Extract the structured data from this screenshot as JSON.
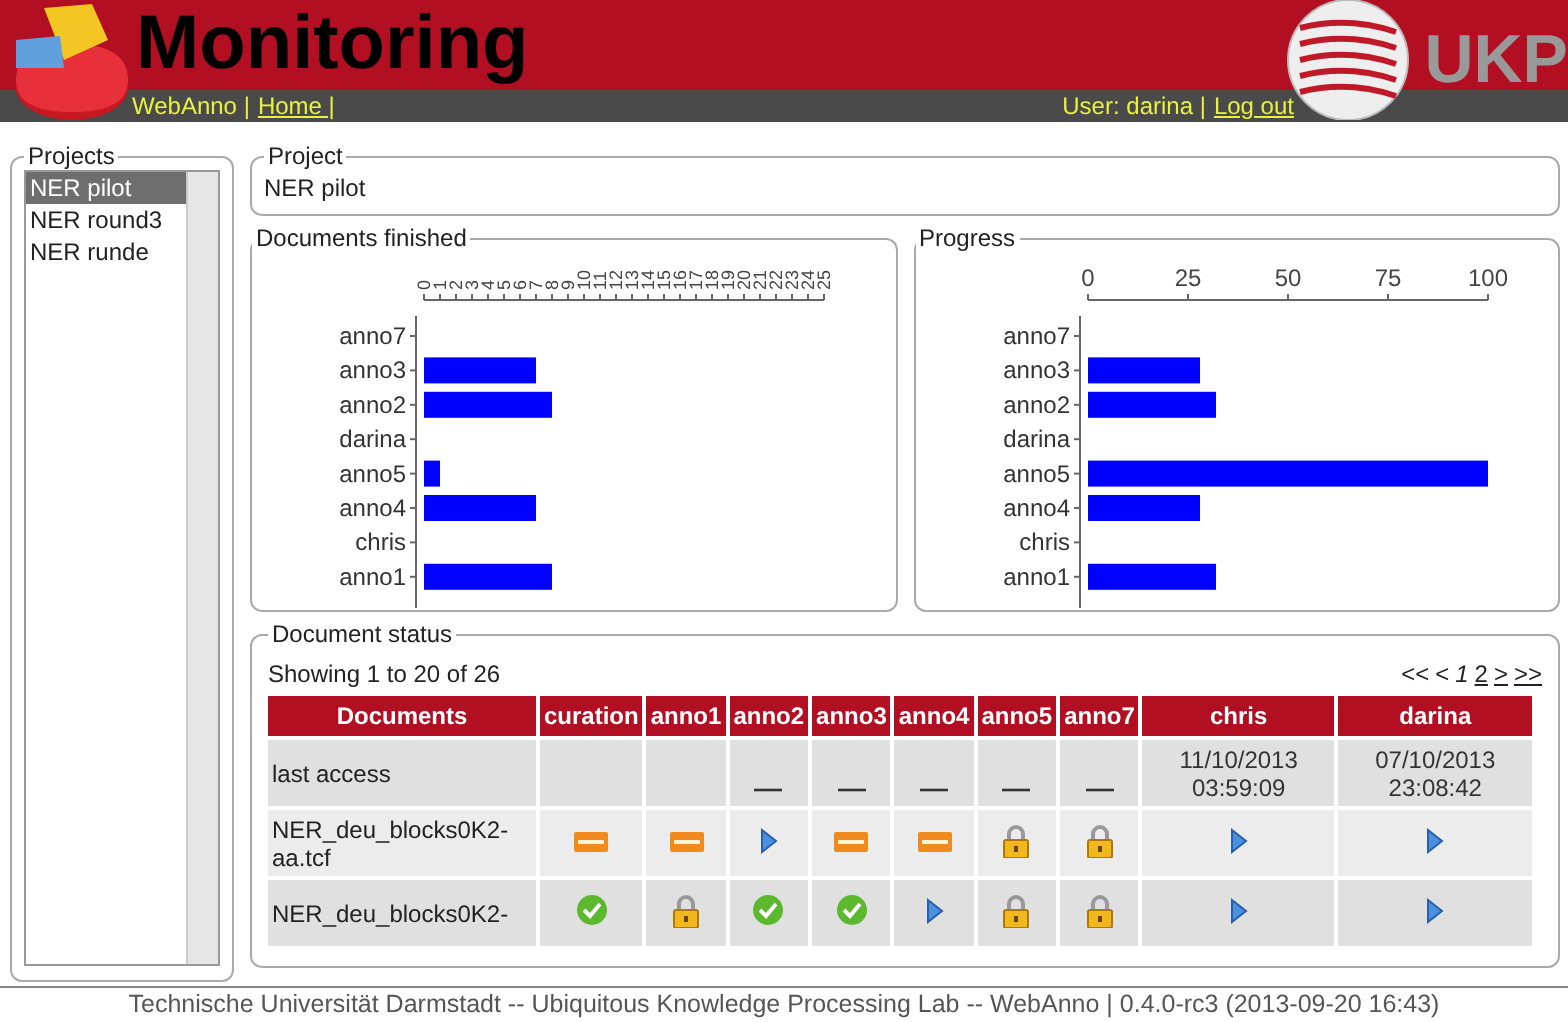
{
  "header": {
    "title": "Monitoring",
    "logo_text": "UKP",
    "nav": [
      {
        "text": "WebAnno |",
        "kind": "text"
      },
      {
        "text": "Home |",
        "kind": "link"
      }
    ],
    "user": [
      {
        "text": "User: darina |",
        "kind": "text"
      },
      {
        "text": "Log out",
        "kind": "link"
      }
    ]
  },
  "projects": {
    "title": "Projects",
    "items": [
      {
        "label": "NER pilot",
        "selected": true
      },
      {
        "label": "NER round3",
        "selected": false
      },
      {
        "label": "NER runde",
        "selected": false
      }
    ]
  },
  "project": {
    "title": "Project",
    "name": "NER pilot"
  },
  "documents_finished": {
    "title": "Documents finished",
    "chart_data": {
      "type": "bar",
      "orientation": "horizontal",
      "categories": [
        "anno7",
        "anno3",
        "anno2",
        "darina",
        "anno5",
        "anno4",
        "chris",
        "anno1"
      ],
      "series": [
        {
          "color": "#0000ff",
          "values": [
            0,
            7,
            8,
            0,
            1,
            7,
            0,
            8
          ]
        }
      ],
      "xlim": [
        0,
        25
      ],
      "xticks": [
        0,
        1,
        2,
        3,
        4,
        5,
        6,
        7,
        8,
        9,
        10,
        11,
        12,
        13,
        14,
        15,
        16,
        17,
        18,
        19,
        20,
        21,
        22,
        23,
        24,
        25
      ]
    }
  },
  "progress": {
    "title": "Progress",
    "chart_data": {
      "type": "bar",
      "orientation": "horizontal",
      "categories": [
        "anno7",
        "anno3",
        "anno2",
        "darina",
        "anno5",
        "anno4",
        "chris",
        "anno1"
      ],
      "series": [
        {
          "color": "#0000ff",
          "values": [
            0,
            28,
            32,
            0,
            100,
            28,
            0,
            32
          ]
        }
      ],
      "xlim": [
        0,
        100
      ],
      "xticks": [
        0,
        25,
        50,
        75,
        100
      ]
    }
  },
  "document_status": {
    "title": "Document status",
    "summary": "Showing 1 to 20 of 26",
    "pager": [
      {
        "text": "<<",
        "kind": "text"
      },
      {
        "text": "<",
        "kind": "text"
      },
      {
        "text": "1",
        "kind": "current"
      },
      {
        "text": "2",
        "kind": "link"
      },
      {
        "text": ">",
        "kind": "link"
      },
      {
        "text": ">>",
        "kind": "link"
      }
    ],
    "columns": [
      "Documents",
      "curation",
      "anno1",
      "anno2",
      "anno3",
      "anno4",
      "anno5",
      "anno7",
      "chris",
      "darina"
    ],
    "rows": [
      {
        "cells": [
          {
            "kind": "text",
            "text": "last access"
          },
          {
            "kind": "empty"
          },
          {
            "kind": "empty"
          },
          {
            "kind": "dash"
          },
          {
            "kind": "dash"
          },
          {
            "kind": "dash"
          },
          {
            "kind": "dash"
          },
          {
            "kind": "dash"
          },
          {
            "kind": "date",
            "text": "11/10/2013 03:59:09"
          },
          {
            "kind": "date",
            "text": "07/10/2013 23:08:42"
          }
        ]
      },
      {
        "cells": [
          {
            "kind": "text",
            "text": "NER_deu_blocks0K2-aa.tcf"
          },
          {
            "kind": "new"
          },
          {
            "kind": "new"
          },
          {
            "kind": "play"
          },
          {
            "kind": "new"
          },
          {
            "kind": "new"
          },
          {
            "kind": "lock"
          },
          {
            "kind": "lock"
          },
          {
            "kind": "play"
          },
          {
            "kind": "play"
          }
        ]
      },
      {
        "cells": [
          {
            "kind": "text",
            "text": "NER_deu_blocks0K2-"
          },
          {
            "kind": "done"
          },
          {
            "kind": "lock"
          },
          {
            "kind": "done"
          },
          {
            "kind": "done"
          },
          {
            "kind": "play"
          },
          {
            "kind": "lock"
          },
          {
            "kind": "lock"
          },
          {
            "kind": "play"
          },
          {
            "kind": "play"
          }
        ]
      }
    ]
  },
  "footer": "Technische Universität Darmstadt -- Ubiquitous Knowledge Processing Lab -- WebAnno | 0.4.0-rc3 (2013-09-20 16:43)"
}
